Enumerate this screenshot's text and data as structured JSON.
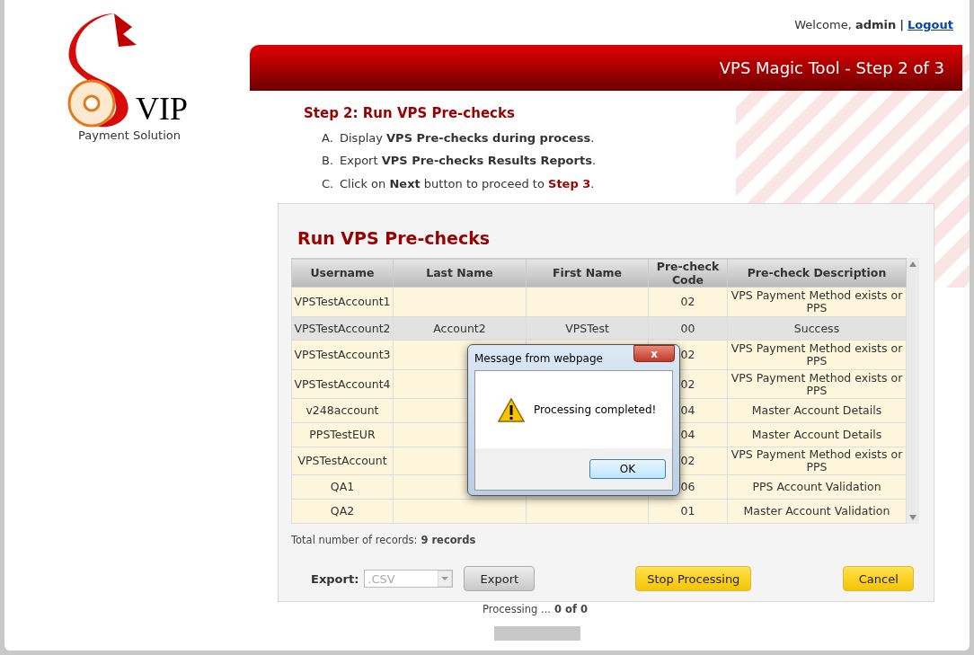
{
  "logo": {
    "brand": "VIP",
    "tagline": "Payment Solution"
  },
  "user_bar": {
    "greeting": "Welcome,",
    "user": "admin",
    "separator": "|",
    "logout": "Logout"
  },
  "banner": {
    "title": "VPS Magic Tool - Step 2 of 3"
  },
  "step": {
    "title": "Step 2: Run VPS Pre-checks",
    "instructions": [
      {
        "marker": "A.",
        "parts": [
          {
            "text": "Display ",
            "kind": "plain"
          },
          {
            "text": "VPS Pre-checks during process",
            "kind": "bold"
          },
          {
            "text": ".",
            "kind": "plain"
          }
        ]
      },
      {
        "marker": "B.",
        "parts": [
          {
            "text": "Export ",
            "kind": "plain"
          },
          {
            "text": "VPS Pre-checks Results Reports",
            "kind": "bold"
          },
          {
            "text": ".",
            "kind": "plain"
          }
        ]
      },
      {
        "marker": "C.",
        "parts": [
          {
            "text": "Click on ",
            "kind": "plain"
          },
          {
            "text": "Next",
            "kind": "bold"
          },
          {
            "text": " button to proceed to ",
            "kind": "plain"
          },
          {
            "text": "Step 3",
            "kind": "step"
          },
          {
            "text": ".",
            "kind": "plain"
          }
        ]
      }
    ]
  },
  "panel": {
    "title": "Run VPS Pre-checks",
    "table": {
      "columns": [
        "Username",
        "Last Name",
        "First Name",
        "Pre-check Code",
        "Pre-check Description"
      ],
      "rows": [
        {
          "username": "VPSTestAccount1",
          "code": "02",
          "description": "VPS Payment Method exists or PPS",
          "selected": false
        },
        {
          "username": "VPSTestAccount2",
          "last_name": "Account2",
          "first_name": "VPSTest",
          "code": "00",
          "description": "Success",
          "selected": true
        },
        {
          "username": "VPSTestAccount3",
          "code": "02",
          "description": "VPS Payment Method exists or PPS",
          "selected": false
        },
        {
          "username": "VPSTestAccount4",
          "code": "02",
          "description": "VPS Payment Method exists or PPS",
          "selected": false
        },
        {
          "username": "v248account",
          "code": "04",
          "description": "Master Account Details",
          "selected": false
        },
        {
          "username": "PPSTestEUR",
          "code": "04",
          "description": "Master Account Details",
          "selected": false
        },
        {
          "username": "VPSTestAccount",
          "code": "02",
          "description": "VPS Payment Method exists or PPS",
          "selected": false
        },
        {
          "username": "QA1",
          "code": "06",
          "description": "PPS Account Validation",
          "selected": false
        },
        {
          "username": "QA2",
          "code": "01",
          "description": "Master Account Validation",
          "selected": false
        }
      ]
    },
    "total_label": "Total number of records:",
    "total_value": "9 records",
    "export_label": "Export:",
    "export_format": ".CSV",
    "export_disabled": true,
    "buttons": {
      "export": "Export",
      "stop": "Stop Processing",
      "cancel": "Cancel"
    }
  },
  "progress": {
    "label": "Processing ...",
    "value": "0 of 0",
    "level": 0
  },
  "dialog": {
    "title": "Message from webpage",
    "message": "Processing completed!",
    "close": "x",
    "ok": "OK"
  }
}
